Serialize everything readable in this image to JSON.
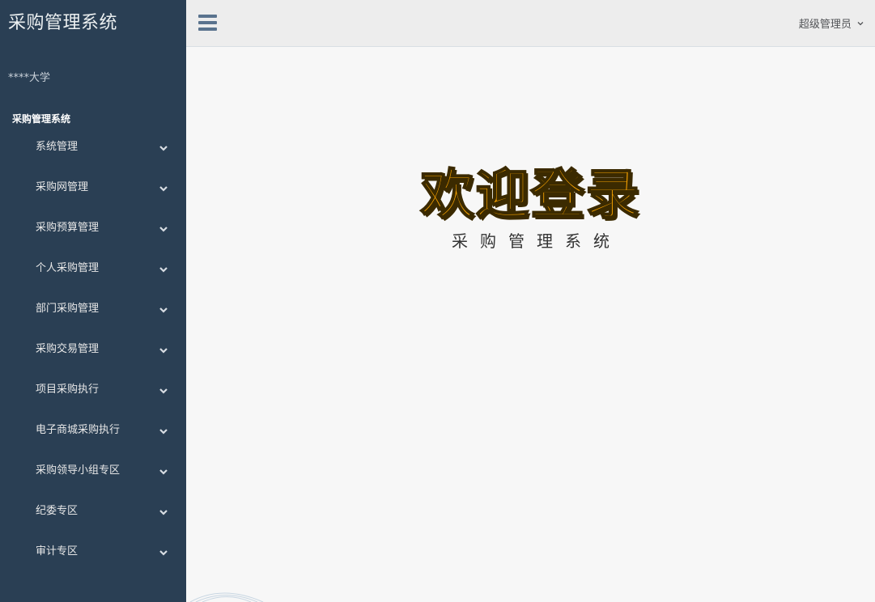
{
  "sidebar": {
    "brand": "采购管理系统",
    "org": "****大学",
    "section_title": "采购管理系统",
    "items": [
      {
        "label": "系统管理",
        "icon": "chevron-down-icon"
      },
      {
        "label": "采购网管理",
        "icon": "chevron-down-icon"
      },
      {
        "label": "采购预算管理",
        "icon": "chevron-down-icon"
      },
      {
        "label": "个人采购管理",
        "icon": "chevron-down-icon"
      },
      {
        "label": "部门采购管理",
        "icon": "chevron-down-icon"
      },
      {
        "label": "采购交易管理",
        "icon": "chevron-down-icon"
      },
      {
        "label": "项目采购执行",
        "icon": "chevron-down-icon"
      },
      {
        "label": "电子商城采购执行",
        "icon": "chevron-down-icon"
      },
      {
        "label": "采购领导小组专区",
        "icon": "chevron-down-icon"
      },
      {
        "label": "纪委专区",
        "icon": "chevron-down-icon"
      },
      {
        "label": "审计专区",
        "icon": "chevron-down-icon"
      }
    ]
  },
  "topbar": {
    "menu_icon": "hamburger-icon",
    "user_label": "超级管理员"
  },
  "main": {
    "welcome": "欢迎登录",
    "subtitle": "采购管理系统"
  },
  "colors": {
    "sidebar_bg": "#2a3f54",
    "welcome_fill": "#f5a100",
    "topbar_bg": "#ededed",
    "content_bg": "#f7f7f7"
  }
}
